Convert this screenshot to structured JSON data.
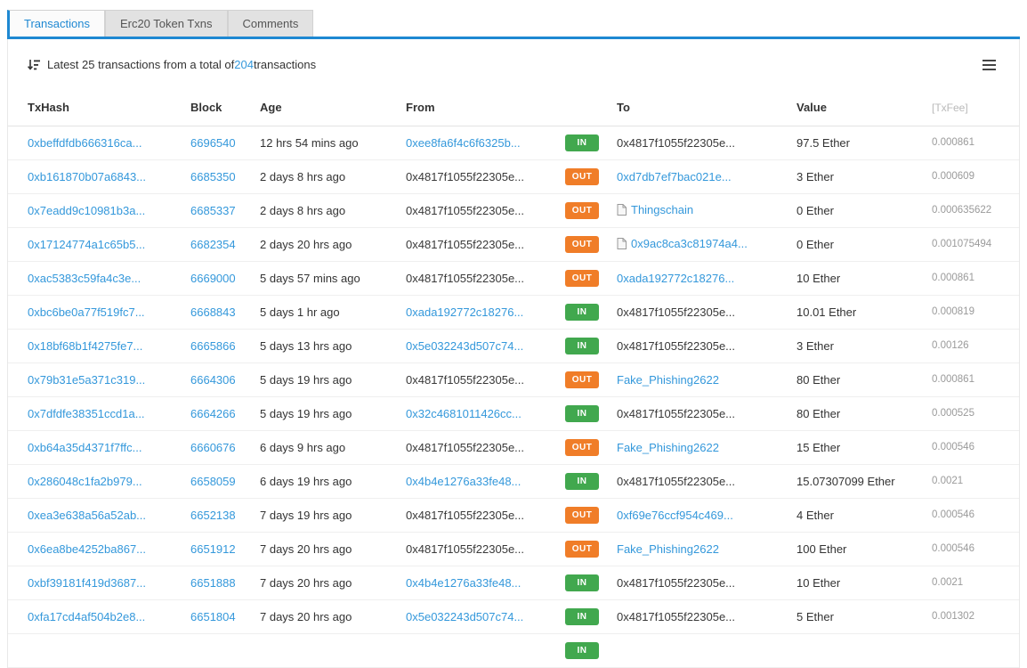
{
  "colors": {
    "accent": "#1e88d2",
    "link": "#3498db",
    "in": "#41a84e",
    "out": "#f07d28",
    "fee": "#9a9a9a"
  },
  "tabs": [
    {
      "label": "Transactions",
      "active": true
    },
    {
      "label": "Erc20 Token Txns",
      "active": false
    },
    {
      "label": "Comments",
      "active": false
    }
  ],
  "header": {
    "sort_icon": "sort-amount-desc-icon",
    "menu_icon": "hamburger-menu-icon",
    "summary_prefix": "Latest 25 transactions from a total of ",
    "total": "204",
    "summary_suffix": " transactions"
  },
  "table": {
    "columns": [
      "TxHash",
      "Block",
      "Age",
      "From",
      "",
      "To",
      "Value",
      "[TxFee]"
    ],
    "rows": [
      {
        "txhash": "0xbeffdfdb666316ca...",
        "block": "6696540",
        "age": "12 hrs 54 mins ago",
        "from": "0xee8fa6f4c6f6325b...",
        "from_link": true,
        "dir": "IN",
        "to": "0x4817f1055f22305e...",
        "to_link": false,
        "to_contract": false,
        "value": "97.5 Ether",
        "fee": "0.000861"
      },
      {
        "txhash": "0xb161870b07a6843...",
        "block": "6685350",
        "age": "2 days 8 hrs ago",
        "from": "0x4817f1055f22305e...",
        "from_link": false,
        "dir": "OUT",
        "to": "0xd7db7ef7bac021e...",
        "to_link": true,
        "to_contract": false,
        "value": "3 Ether",
        "fee": "0.000609"
      },
      {
        "txhash": "0x7eadd9c10981b3a...",
        "block": "6685337",
        "age": "2 days 8 hrs ago",
        "from": "0x4817f1055f22305e...",
        "from_link": false,
        "dir": "OUT",
        "to": "Thingschain",
        "to_link": true,
        "to_contract": true,
        "value": "0 Ether",
        "fee": "0.000635622"
      },
      {
        "txhash": "0x17124774a1c65b5...",
        "block": "6682354",
        "age": "2 days 20 hrs ago",
        "from": "0x4817f1055f22305e...",
        "from_link": false,
        "dir": "OUT",
        "to": "0x9ac8ca3c81974a4...",
        "to_link": true,
        "to_contract": true,
        "value": "0 Ether",
        "fee": "0.001075494"
      },
      {
        "txhash": "0xac5383c59fa4c3e...",
        "block": "6669000",
        "age": "5 days 57 mins ago",
        "from": "0x4817f1055f22305e...",
        "from_link": false,
        "dir": "OUT",
        "to": "0xada192772c18276...",
        "to_link": true,
        "to_contract": false,
        "value": "10 Ether",
        "fee": "0.000861"
      },
      {
        "txhash": "0xbc6be0a77f519fc7...",
        "block": "6668843",
        "age": "5 days 1 hr ago",
        "from": "0xada192772c18276...",
        "from_link": true,
        "dir": "IN",
        "to": "0x4817f1055f22305e...",
        "to_link": false,
        "to_contract": false,
        "value": "10.01 Ether",
        "fee": "0.000819"
      },
      {
        "txhash": "0x18bf68b1f4275fe7...",
        "block": "6665866",
        "age": "5 days 13 hrs ago",
        "from": "0x5e032243d507c74...",
        "from_link": true,
        "dir": "IN",
        "to": "0x4817f1055f22305e...",
        "to_link": false,
        "to_contract": false,
        "value": "3 Ether",
        "fee": "0.00126"
      },
      {
        "txhash": "0x79b31e5a371c319...",
        "block": "6664306",
        "age": "5 days 19 hrs ago",
        "from": "0x4817f1055f22305e...",
        "from_link": false,
        "dir": "OUT",
        "to": "Fake_Phishing2622",
        "to_link": true,
        "to_contract": false,
        "value": "80 Ether",
        "fee": "0.000861"
      },
      {
        "txhash": "0x7dfdfe38351ccd1a...",
        "block": "6664266",
        "age": "5 days 19 hrs ago",
        "from": "0x32c4681011426cc...",
        "from_link": true,
        "dir": "IN",
        "to": "0x4817f1055f22305e...",
        "to_link": false,
        "to_contract": false,
        "value": "80 Ether",
        "fee": "0.000525"
      },
      {
        "txhash": "0xb64a35d4371f7ffc...",
        "block": "6660676",
        "age": "6 days 9 hrs ago",
        "from": "0x4817f1055f22305e...",
        "from_link": false,
        "dir": "OUT",
        "to": "Fake_Phishing2622",
        "to_link": true,
        "to_contract": false,
        "value": "15 Ether",
        "fee": "0.000546"
      },
      {
        "txhash": "0x286048c1fa2b979...",
        "block": "6658059",
        "age": "6 days 19 hrs ago",
        "from": "0x4b4e1276a33fe48...",
        "from_link": true,
        "dir": "IN",
        "to": "0x4817f1055f22305e...",
        "to_link": false,
        "to_contract": false,
        "value": "15.07307099 Ether",
        "fee": "0.0021"
      },
      {
        "txhash": "0xea3e638a56a52ab...",
        "block": "6652138",
        "age": "7 days 19 hrs ago",
        "from": "0x4817f1055f22305e...",
        "from_link": false,
        "dir": "OUT",
        "to": "0xf69e76ccf954c469...",
        "to_link": true,
        "to_contract": false,
        "value": "4 Ether",
        "fee": "0.000546"
      },
      {
        "txhash": "0x6ea8be4252ba867...",
        "block": "6651912",
        "age": "7 days 20 hrs ago",
        "from": "0x4817f1055f22305e...",
        "from_link": false,
        "dir": "OUT",
        "to": "Fake_Phishing2622",
        "to_link": true,
        "to_contract": false,
        "value": "100 Ether",
        "fee": "0.000546"
      },
      {
        "txhash": "0xbf39181f419d3687...",
        "block": "6651888",
        "age": "7 days 20 hrs ago",
        "from": "0x4b4e1276a33fe48...",
        "from_link": true,
        "dir": "IN",
        "to": "0x4817f1055f22305e...",
        "to_link": false,
        "to_contract": false,
        "value": "10 Ether",
        "fee": "0.0021"
      },
      {
        "txhash": "0xfa17cd4af504b2e8...",
        "block": "6651804",
        "age": "7 days 20 hrs ago",
        "from": "0x5e032243d507c74...",
        "from_link": true,
        "dir": "IN",
        "to": "0x4817f1055f22305e...",
        "to_link": false,
        "to_contract": false,
        "value": "5 Ether",
        "fee": "0.001302"
      },
      {
        "txhash": "",
        "block": "",
        "age": "",
        "from": "",
        "from_link": false,
        "dir": "IN",
        "to": "",
        "to_link": false,
        "to_contract": false,
        "value": "",
        "fee": ""
      }
    ]
  }
}
